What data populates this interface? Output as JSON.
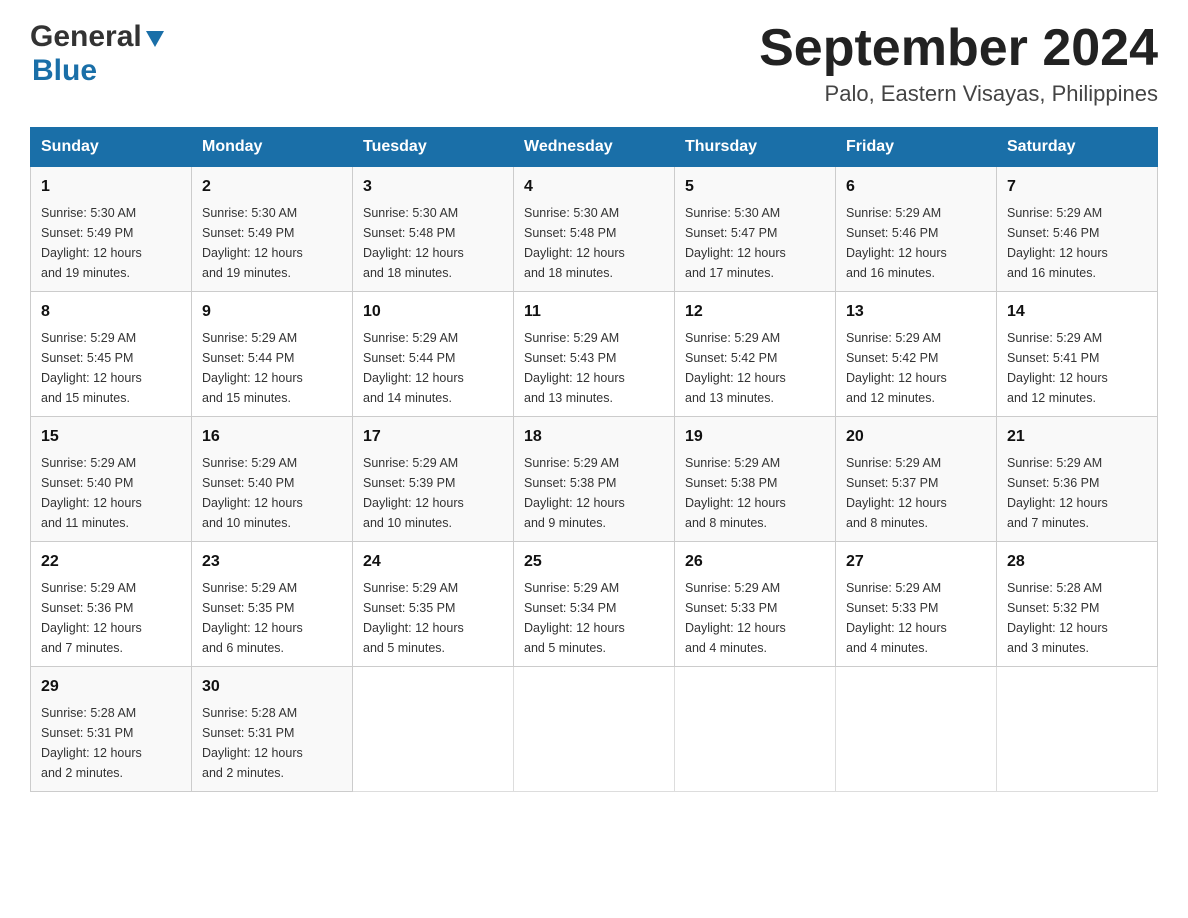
{
  "header": {
    "logo_general": "General",
    "logo_blue": "Blue",
    "title": "September 2024",
    "subtitle": "Palo, Eastern Visayas, Philippines"
  },
  "days_of_week": [
    "Sunday",
    "Monday",
    "Tuesday",
    "Wednesday",
    "Thursday",
    "Friday",
    "Saturday"
  ],
  "weeks": [
    [
      {
        "day": "1",
        "sunrise": "5:30 AM",
        "sunset": "5:49 PM",
        "daylight": "12 hours and 19 minutes."
      },
      {
        "day": "2",
        "sunrise": "5:30 AM",
        "sunset": "5:49 PM",
        "daylight": "12 hours and 19 minutes."
      },
      {
        "day": "3",
        "sunrise": "5:30 AM",
        "sunset": "5:48 PM",
        "daylight": "12 hours and 18 minutes."
      },
      {
        "day": "4",
        "sunrise": "5:30 AM",
        "sunset": "5:48 PM",
        "daylight": "12 hours and 18 minutes."
      },
      {
        "day": "5",
        "sunrise": "5:30 AM",
        "sunset": "5:47 PM",
        "daylight": "12 hours and 17 minutes."
      },
      {
        "day": "6",
        "sunrise": "5:29 AM",
        "sunset": "5:46 PM",
        "daylight": "12 hours and 16 minutes."
      },
      {
        "day": "7",
        "sunrise": "5:29 AM",
        "sunset": "5:46 PM",
        "daylight": "12 hours and 16 minutes."
      }
    ],
    [
      {
        "day": "8",
        "sunrise": "5:29 AM",
        "sunset": "5:45 PM",
        "daylight": "12 hours and 15 minutes."
      },
      {
        "day": "9",
        "sunrise": "5:29 AM",
        "sunset": "5:44 PM",
        "daylight": "12 hours and 15 minutes."
      },
      {
        "day": "10",
        "sunrise": "5:29 AM",
        "sunset": "5:44 PM",
        "daylight": "12 hours and 14 minutes."
      },
      {
        "day": "11",
        "sunrise": "5:29 AM",
        "sunset": "5:43 PM",
        "daylight": "12 hours and 13 minutes."
      },
      {
        "day": "12",
        "sunrise": "5:29 AM",
        "sunset": "5:42 PM",
        "daylight": "12 hours and 13 minutes."
      },
      {
        "day": "13",
        "sunrise": "5:29 AM",
        "sunset": "5:42 PM",
        "daylight": "12 hours and 12 minutes."
      },
      {
        "day": "14",
        "sunrise": "5:29 AM",
        "sunset": "5:41 PM",
        "daylight": "12 hours and 12 minutes."
      }
    ],
    [
      {
        "day": "15",
        "sunrise": "5:29 AM",
        "sunset": "5:40 PM",
        "daylight": "12 hours and 11 minutes."
      },
      {
        "day": "16",
        "sunrise": "5:29 AM",
        "sunset": "5:40 PM",
        "daylight": "12 hours and 10 minutes."
      },
      {
        "day": "17",
        "sunrise": "5:29 AM",
        "sunset": "5:39 PM",
        "daylight": "12 hours and 10 minutes."
      },
      {
        "day": "18",
        "sunrise": "5:29 AM",
        "sunset": "5:38 PM",
        "daylight": "12 hours and 9 minutes."
      },
      {
        "day": "19",
        "sunrise": "5:29 AM",
        "sunset": "5:38 PM",
        "daylight": "12 hours and 8 minutes."
      },
      {
        "day": "20",
        "sunrise": "5:29 AM",
        "sunset": "5:37 PM",
        "daylight": "12 hours and 8 minutes."
      },
      {
        "day": "21",
        "sunrise": "5:29 AM",
        "sunset": "5:36 PM",
        "daylight": "12 hours and 7 minutes."
      }
    ],
    [
      {
        "day": "22",
        "sunrise": "5:29 AM",
        "sunset": "5:36 PM",
        "daylight": "12 hours and 7 minutes."
      },
      {
        "day": "23",
        "sunrise": "5:29 AM",
        "sunset": "5:35 PM",
        "daylight": "12 hours and 6 minutes."
      },
      {
        "day": "24",
        "sunrise": "5:29 AM",
        "sunset": "5:35 PM",
        "daylight": "12 hours and 5 minutes."
      },
      {
        "day": "25",
        "sunrise": "5:29 AM",
        "sunset": "5:34 PM",
        "daylight": "12 hours and 5 minutes."
      },
      {
        "day": "26",
        "sunrise": "5:29 AM",
        "sunset": "5:33 PM",
        "daylight": "12 hours and 4 minutes."
      },
      {
        "day": "27",
        "sunrise": "5:29 AM",
        "sunset": "5:33 PM",
        "daylight": "12 hours and 4 minutes."
      },
      {
        "day": "28",
        "sunrise": "5:28 AM",
        "sunset": "5:32 PM",
        "daylight": "12 hours and 3 minutes."
      }
    ],
    [
      {
        "day": "29",
        "sunrise": "5:28 AM",
        "sunset": "5:31 PM",
        "daylight": "12 hours and 2 minutes."
      },
      {
        "day": "30",
        "sunrise": "5:28 AM",
        "sunset": "5:31 PM",
        "daylight": "12 hours and 2 minutes."
      },
      null,
      null,
      null,
      null,
      null
    ]
  ],
  "labels": {
    "sunrise": "Sunrise:",
    "sunset": "Sunset:",
    "daylight": "Daylight:"
  }
}
